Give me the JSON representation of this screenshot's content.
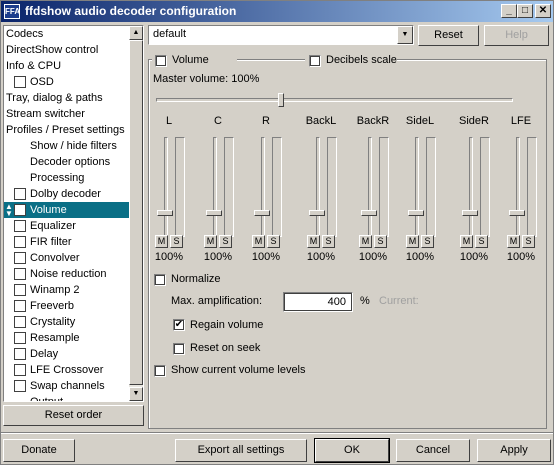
{
  "window": {
    "app_icon": "FFA",
    "title": "ffdshow audio decoder configuration",
    "minimize_label": "_",
    "maximize_label": "□",
    "close_label": "✕"
  },
  "sidebar": {
    "items": [
      {
        "label": "Codecs",
        "indent": 0,
        "checkbox": false
      },
      {
        "label": "DirectShow control",
        "indent": 0,
        "checkbox": false
      },
      {
        "label": "Info & CPU",
        "indent": 0,
        "checkbox": false
      },
      {
        "label": "OSD",
        "indent": 1,
        "checkbox": true
      },
      {
        "label": "Tray, dialog & paths",
        "indent": 0,
        "checkbox": false
      },
      {
        "label": "Stream switcher",
        "indent": 0,
        "checkbox": false
      },
      {
        "label": "Profiles / Preset settings",
        "indent": 0,
        "checkbox": false
      },
      {
        "label": "Show / hide filters",
        "indent": 2,
        "checkbox": false
      },
      {
        "label": "Decoder options",
        "indent": 2,
        "checkbox": false
      },
      {
        "label": "Processing",
        "indent": 2,
        "checkbox": false
      },
      {
        "label": "Dolby decoder",
        "indent": 1,
        "checkbox": true
      },
      {
        "label": "Volume",
        "indent": 1,
        "checkbox": true,
        "selected": true
      },
      {
        "label": "Equalizer",
        "indent": 1,
        "checkbox": true
      },
      {
        "label": "FIR filter",
        "indent": 1,
        "checkbox": true
      },
      {
        "label": "Convolver",
        "indent": 1,
        "checkbox": true
      },
      {
        "label": "Noise reduction",
        "indent": 1,
        "checkbox": true
      },
      {
        "label": "Winamp 2",
        "indent": 1,
        "checkbox": true
      },
      {
        "label": "Freeverb",
        "indent": 1,
        "checkbox": true
      },
      {
        "label": "Crystality",
        "indent": 1,
        "checkbox": true
      },
      {
        "label": "Resample",
        "indent": 1,
        "checkbox": true
      },
      {
        "label": "Delay",
        "indent": 1,
        "checkbox": true
      },
      {
        "label": "LFE Crossover",
        "indent": 1,
        "checkbox": true
      },
      {
        "label": "Swap channels",
        "indent": 1,
        "checkbox": true
      },
      {
        "label": "Output",
        "indent": 2,
        "checkbox": false
      }
    ],
    "reset_order_label": "Reset order"
  },
  "preset": {
    "value": "default",
    "reset_label": "Reset",
    "help_label": "Help"
  },
  "volume": {
    "enable_label": "Volume",
    "decibels_label": "Decibels scale",
    "master_label": "Master volume: 100%",
    "master_level": 0.35,
    "channels": [
      {
        "name": "L",
        "value": "100%",
        "level": 0.5
      },
      {
        "name": "C",
        "value": "100%",
        "level": 0.5
      },
      {
        "name": "R",
        "value": "100%",
        "level": 0.5
      },
      {
        "name": "BackL",
        "value": "100%",
        "level": 0.5
      },
      {
        "name": "BackR",
        "value": "100%",
        "level": 0.5
      },
      {
        "name": "SideL",
        "value": "100%",
        "level": 0.5
      },
      {
        "name": "SideR",
        "value": "100%",
        "level": 0.5
      },
      {
        "name": "LFE",
        "value": "100%",
        "level": 0.5
      }
    ],
    "mute_label": "M",
    "solo_label": "S",
    "normalize_label": "Normalize",
    "max_amp_label": "Max. amplification:",
    "max_amp_value": "400",
    "percent_label": "%",
    "current_label": "Current:",
    "regain_label": "Regain volume",
    "regain_checked": true,
    "reset_on_seek_label": "Reset on seek",
    "show_levels_label": "Show current volume levels"
  },
  "footer": {
    "donate_label": "Donate",
    "export_label": "Export all settings",
    "ok_label": "OK",
    "cancel_label": "Cancel",
    "apply_label": "Apply"
  },
  "colors": {
    "selection": "#0a6f86",
    "titlebar_start": "#0a246a",
    "titlebar_end": "#a6caf0",
    "face": "#d4d0c8"
  }
}
